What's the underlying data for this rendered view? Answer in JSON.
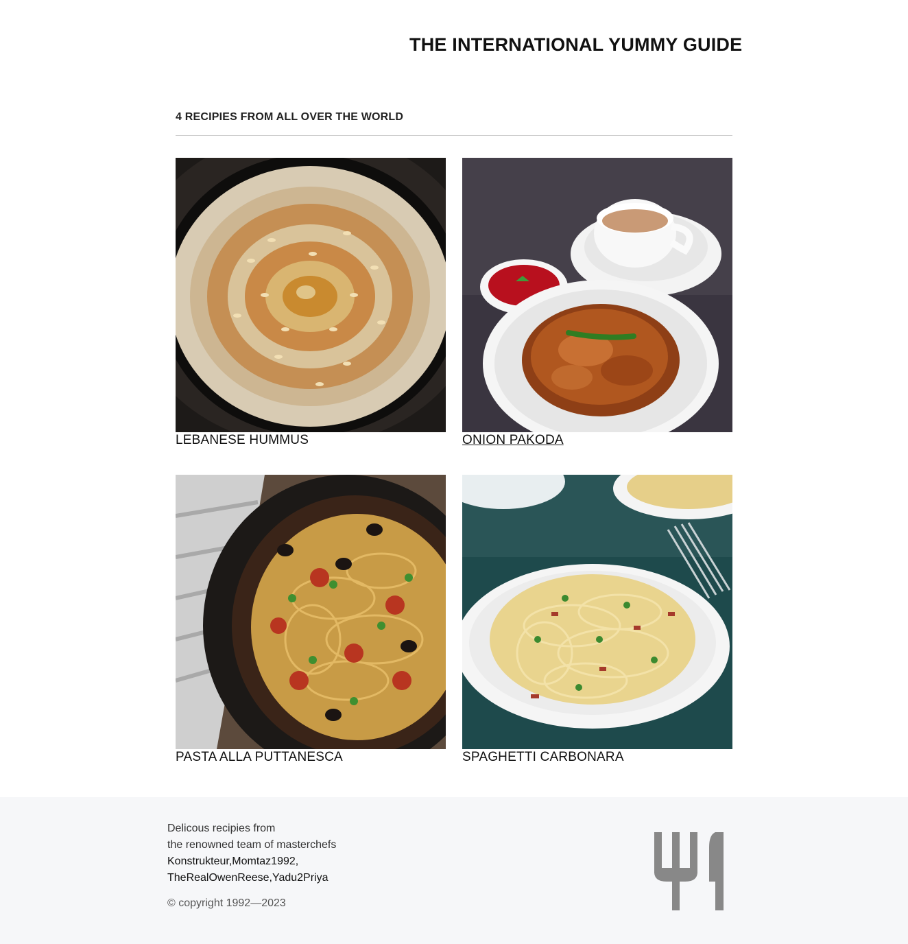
{
  "header": {
    "site_title": "THE INTERNATIONAL YUMMY GUIDE"
  },
  "main": {
    "section_heading": "4 RECIPIES FROM ALL OVER THE WORLD",
    "recipes": [
      {
        "title": "LEBANESE HUMMUS",
        "image_icon": "hummus-photo"
      },
      {
        "title": "ONION PAKODA",
        "image_icon": "onion-pakoda-photo",
        "hovered": true
      },
      {
        "title": "PASTA ALLA PUTTANESCA",
        "image_icon": "puttanesca-photo"
      },
      {
        "title": "SPAGHETTI CARBONARA",
        "image_icon": "carbonara-photo"
      }
    ]
  },
  "footer": {
    "line1": "Delicous recipies from",
    "line2": "the renowned team of masterchefs",
    "line3": "Konstrukteur,Momtaz1992,",
    "line4": "TheRealOwenReese,Yadu2Priya",
    "copyright": "© copyright 1992—2023",
    "logo_icon": "fork-knife-icon",
    "logo_color": "#888888"
  }
}
